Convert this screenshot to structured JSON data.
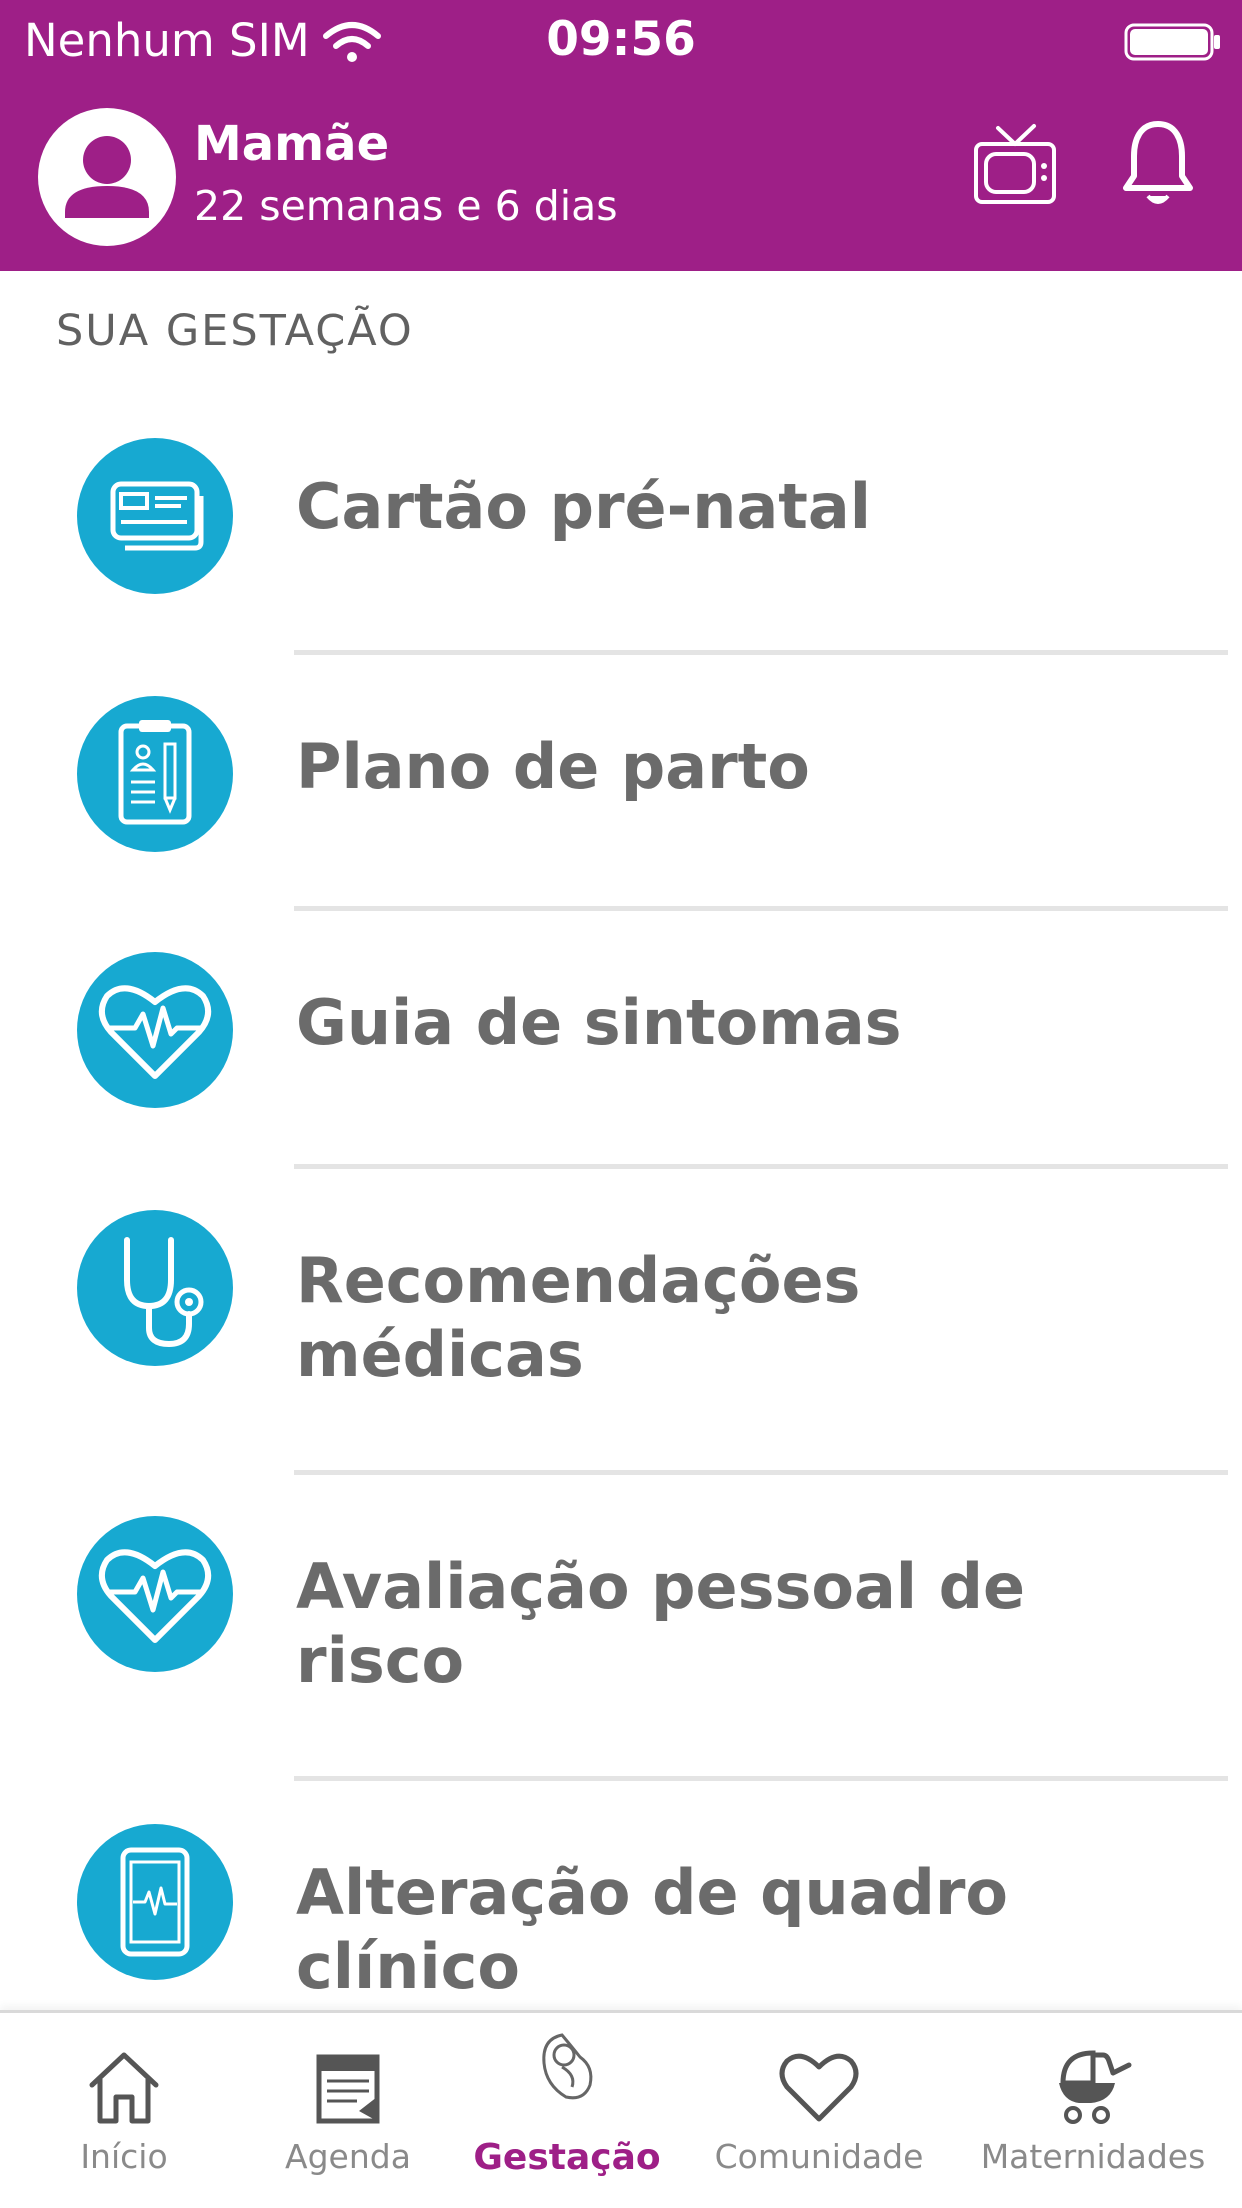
{
  "status_bar": {
    "carrier": "Nenhum SIM",
    "time": "09:56"
  },
  "profile": {
    "name": "Mamãe",
    "pregnancy_time": "22 semanas e 6 dias"
  },
  "section": {
    "title": "SUA GESTAÇÃO"
  },
  "menu": [
    {
      "label": "Cartão pré-natal",
      "icon": "card-icon"
    },
    {
      "label": "Plano de parto",
      "icon": "clipboard-icon"
    },
    {
      "label": "Guia de sintomas",
      "icon": "heart-pulse-icon"
    },
    {
      "label": "Recomendações médicas",
      "icon": "stethoscope-icon"
    },
    {
      "label": "Avaliação pessoal de risco",
      "icon": "heart-pulse-icon"
    },
    {
      "label": "Alteração de quadro clínico",
      "icon": "tablet-pulse-icon"
    }
  ],
  "tabs": [
    {
      "label": "Início",
      "icon": "home-icon",
      "active": false
    },
    {
      "label": "Agenda",
      "icon": "calendar-icon",
      "active": false
    },
    {
      "label": "Gestação",
      "icon": "baby-icon",
      "active": true
    },
    {
      "label": "Comunidade",
      "icon": "heart-icon",
      "active": false
    },
    {
      "label": "Maternidades",
      "icon": "stroller-icon",
      "active": false
    }
  ],
  "colors": {
    "brand": "#9e1f87",
    "icon_bg": "#17a9d1",
    "text_gray": "#6b6b6b"
  }
}
